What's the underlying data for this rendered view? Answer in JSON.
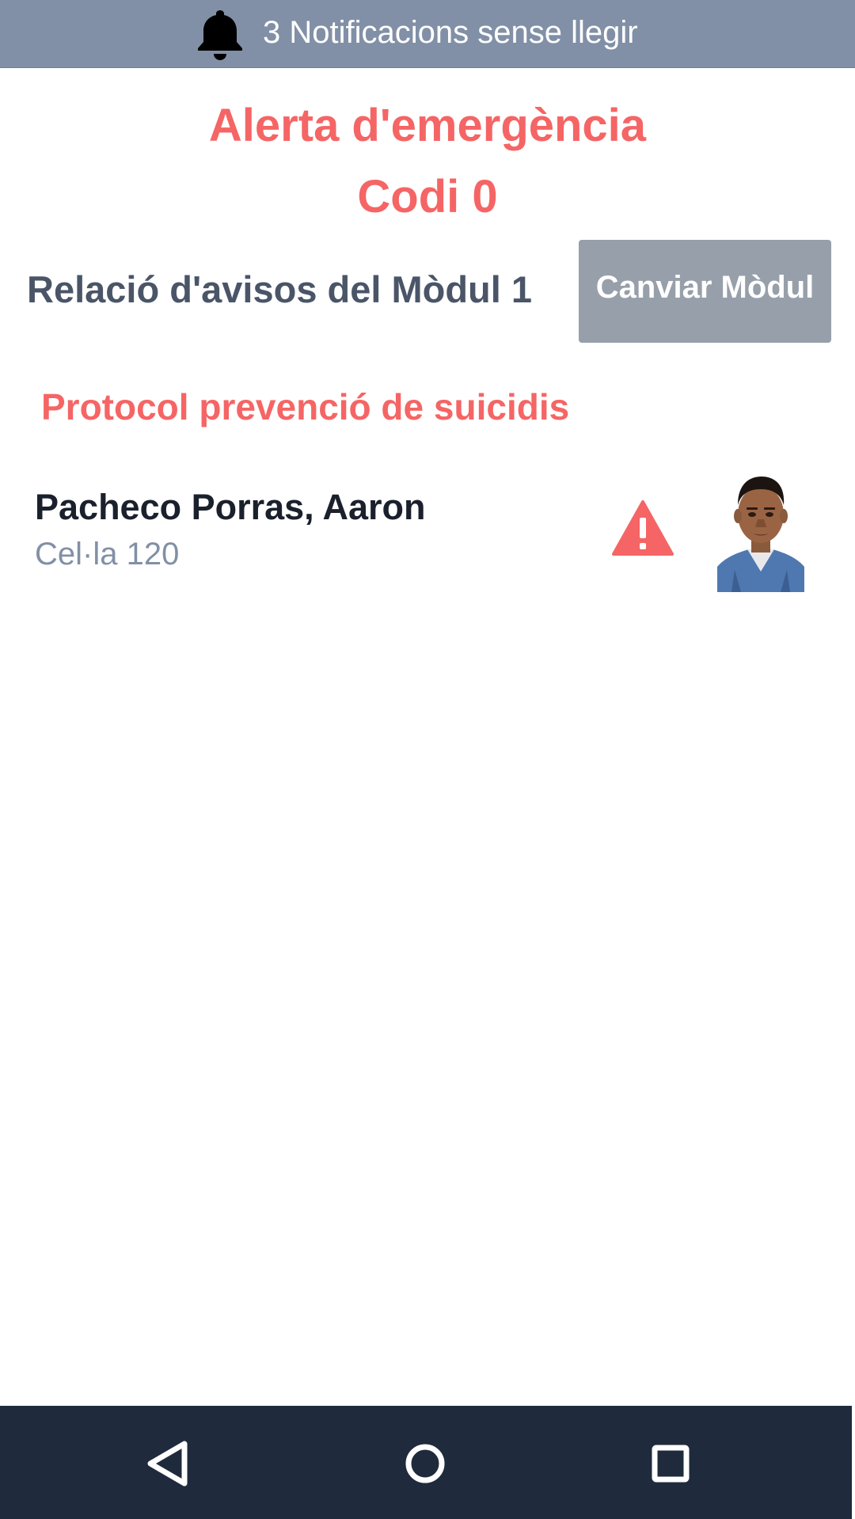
{
  "notification_bar": {
    "icon": "bell-icon",
    "text": "3 Notificacions sense llegir"
  },
  "alert": {
    "title": "Alerta d'emergència",
    "code": "Codi 0"
  },
  "module": {
    "label": "Relació d'avisos del Mòdul 1",
    "change_button_label": "Canviar Mòdul"
  },
  "protocol": {
    "title": "Protocol prevenció de suicidis"
  },
  "inmates": [
    {
      "name": "Pacheco Porras, Aaron",
      "cell": "Cel·la 120",
      "status_icon": "warning-icon"
    }
  ],
  "navigation": {
    "items": [
      "back-icon",
      "home-icon",
      "recent-apps-icon"
    ]
  },
  "colors": {
    "accent_red": "#f56565",
    "notification_bar": "#8190a6",
    "button_gray": "#979faa",
    "nav_bar": "#1f2b3c",
    "label_dark": "#4a5568",
    "name_dark": "#1a202c",
    "muted": "#8190a6"
  }
}
